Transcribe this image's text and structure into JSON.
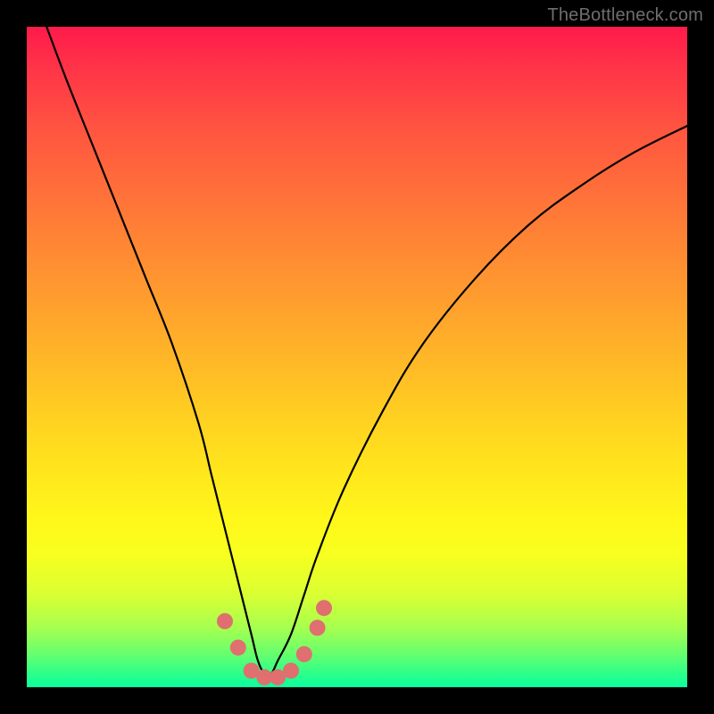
{
  "watermark": "TheBottleneck.com",
  "chart_data": {
    "type": "line",
    "title": "",
    "xlabel": "",
    "ylabel": "",
    "xlim": [
      0,
      100
    ],
    "ylim": [
      0,
      100
    ],
    "grid": false,
    "legend": false,
    "series": [
      {
        "name": "bottleneck-curve",
        "x": [
          3,
          6,
          10,
          14,
          18,
          22,
          26,
          28,
          30,
          32,
          34,
          35,
          36,
          37,
          38,
          40,
          42,
          44,
          48,
          54,
          60,
          68,
          76,
          84,
          92,
          100
        ],
        "y": [
          100,
          92,
          82,
          72,
          62,
          52,
          40,
          32,
          24,
          16,
          8,
          4,
          2,
          2,
          4,
          8,
          14,
          20,
          30,
          42,
          52,
          62,
          70,
          76,
          81,
          85
        ]
      }
    ],
    "markers": {
      "name": "highlight-points",
      "color": "#e06f6f",
      "points": [
        {
          "x": 30,
          "y": 10
        },
        {
          "x": 32,
          "y": 6
        },
        {
          "x": 34,
          "y": 2.5
        },
        {
          "x": 36,
          "y": 1.5
        },
        {
          "x": 38,
          "y": 1.5
        },
        {
          "x": 40,
          "y": 2.5
        },
        {
          "x": 42,
          "y": 5
        },
        {
          "x": 44,
          "y": 9
        },
        {
          "x": 45,
          "y": 12
        }
      ]
    },
    "gradient_stops": [
      {
        "pct": 0,
        "color": "#ff1a4b"
      },
      {
        "pct": 16,
        "color": "#ff5640"
      },
      {
        "pct": 44,
        "color": "#ffa52c"
      },
      {
        "pct": 66,
        "color": "#ffe31d"
      },
      {
        "pct": 86,
        "color": "#d9ff33"
      },
      {
        "pct": 100,
        "color": "#0aff9d"
      }
    ]
  }
}
